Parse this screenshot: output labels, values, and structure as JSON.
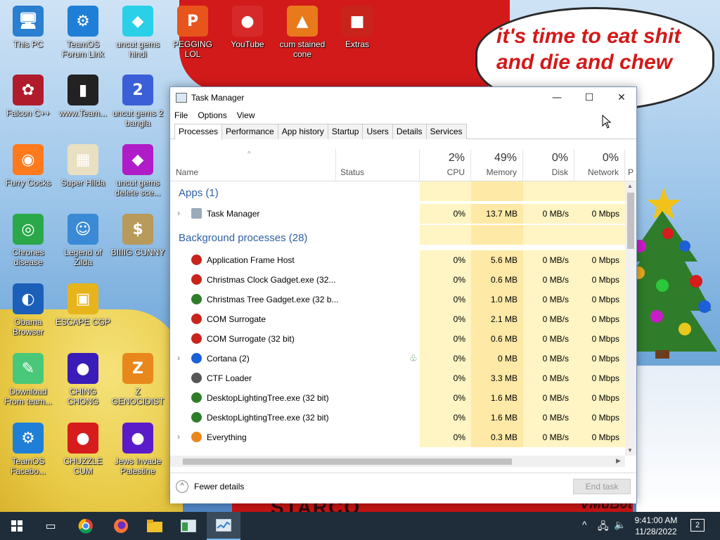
{
  "desktop": {
    "icons": [
      {
        "label": "This PC",
        "glyph": "🖥",
        "color": "#2a7fd0"
      },
      {
        "label": "TeamOS Forum Link",
        "glyph": "⚙",
        "color": "#1f7fd6"
      },
      {
        "label": "uncut gems hindi",
        "glyph": "◆",
        "color": "#2ad0e8"
      },
      {
        "label": "PEGGING LOL",
        "glyph": "P",
        "color": "#e8551c"
      },
      {
        "label": "YouTube",
        "glyph": "●",
        "color": "#d62a2a"
      },
      {
        "label": "cum stained cone",
        "glyph": "▲",
        "color": "#e87a1c"
      },
      {
        "label": "Extras",
        "glyph": "■",
        "color": "#c8241c"
      },
      {
        "label": "Falcon C++",
        "glyph": "✿",
        "color": "#b01c2c"
      },
      {
        "label": "www.Team...",
        "glyph": "▮",
        "color": "#222222"
      },
      {
        "label": "uncut gems 2 bangla",
        "glyph": "2",
        "color": "#3a5fd6"
      },
      {
        "label": "Furry Cocks",
        "glyph": "◉",
        "color": "#ff7a1c"
      },
      {
        "label": "Super Hilda",
        "glyph": "▦",
        "color": "#e8e0c0"
      },
      {
        "label": "uncut gems delete sce...",
        "glyph": "◆",
        "color": "#b01cc8"
      },
      {
        "label": "Chrones disease",
        "glyph": "◎",
        "color": "#2aa84a"
      },
      {
        "label": "Legend of Zilda",
        "glyph": "☺",
        "color": "#3a8ad6"
      },
      {
        "label": "BIIIIG CUNNY",
        "glyph": "$",
        "color": "#b89a5a"
      },
      {
        "label": "Obama Browser",
        "glyph": "◐",
        "color": "#1c5fb8"
      },
      {
        "label": "ESCAPE CGP",
        "glyph": "▣",
        "color": "#e8b41c"
      },
      {
        "label": "Download From team...",
        "glyph": "✎",
        "color": "#4ac87a"
      },
      {
        "label": "CHING CHONG",
        "glyph": "●",
        "color": "#3a1cb8"
      },
      {
        "label": "Z GENOCIDIST",
        "glyph": "Z",
        "color": "#e8881c"
      },
      {
        "label": "TeamOS Facebo...",
        "glyph": "⚙",
        "color": "#1f7fd6"
      },
      {
        "label": "CHUZZLE CUM",
        "glyph": "●",
        "color": "#d61c1c"
      },
      {
        "label": "Jews Invade Palestine",
        "glyph": "●",
        "color": "#5a1cc8"
      }
    ],
    "speech_bubble": "it's time to eat shit and die and chew",
    "sign_text": "STARCO",
    "signature": "VMuB0t"
  },
  "window": {
    "title": "Task Manager",
    "menu": [
      "File",
      "Options",
      "View"
    ],
    "tabs": [
      "Processes",
      "Performance",
      "App history",
      "Startup",
      "Users",
      "Details",
      "Services"
    ],
    "active_tab": "Processes",
    "columns": {
      "name": "Name",
      "status": "Status",
      "cpu": {
        "pct": "2%",
        "label": "CPU"
      },
      "memory": {
        "pct": "49%",
        "label": "Memory"
      },
      "disk": {
        "pct": "0%",
        "label": "Disk"
      },
      "network": {
        "pct": "0%",
        "label": "Network"
      },
      "extra": "P"
    },
    "groups": {
      "apps": "Apps (1)",
      "background": "Background processes (28)"
    },
    "apps": [
      {
        "name": "Task Manager",
        "cpu": "0%",
        "mem": "13.7 MB",
        "disk": "0 MB/s",
        "net": "0 Mbps"
      }
    ],
    "processes": [
      {
        "name": "Application Frame Host",
        "cpu": "0%",
        "mem": "5.6 MB",
        "disk": "0 MB/s",
        "net": "0 Mbps"
      },
      {
        "name": "Christmas Clock Gadget.exe (32...",
        "cpu": "0%",
        "mem": "0.6 MB",
        "disk": "0 MB/s",
        "net": "0 Mbps"
      },
      {
        "name": "Christmas Tree Gadget.exe (32 b...",
        "cpu": "0%",
        "mem": "1.0 MB",
        "disk": "0 MB/s",
        "net": "0 Mbps"
      },
      {
        "name": "COM Surrogate",
        "cpu": "0%",
        "mem": "2.1 MB",
        "disk": "0 MB/s",
        "net": "0 Mbps"
      },
      {
        "name": "COM Surrogate (32 bit)",
        "cpu": "0%",
        "mem": "0.6 MB",
        "disk": "0 MB/s",
        "net": "0 Mbps"
      },
      {
        "name": "Cortana (2)",
        "cpu": "0%",
        "mem": "0 MB",
        "disk": "0 MB/s",
        "net": "0 Mbps"
      },
      {
        "name": "CTF Loader",
        "cpu": "0%",
        "mem": "3.3 MB",
        "disk": "0 MB/s",
        "net": "0 Mbps"
      },
      {
        "name": "DesktopLightingTree.exe (32 bit)",
        "cpu": "0%",
        "mem": "1.6 MB",
        "disk": "0 MB/s",
        "net": "0 Mbps"
      },
      {
        "name": "DesktopLightingTree.exe (32 bit)",
        "cpu": "0%",
        "mem": "1.6 MB",
        "disk": "0 MB/s",
        "net": "0 Mbps"
      },
      {
        "name": "Everything",
        "cpu": "0%",
        "mem": "0.3 MB",
        "disk": "0 MB/s",
        "net": "0 Mbps"
      }
    ],
    "footer": {
      "fewer_details": "Fewer details",
      "end_task": "End task"
    }
  },
  "taskbar": {
    "time": "9:41:00 AM",
    "date": "11/28/2022",
    "notifications": "2"
  }
}
